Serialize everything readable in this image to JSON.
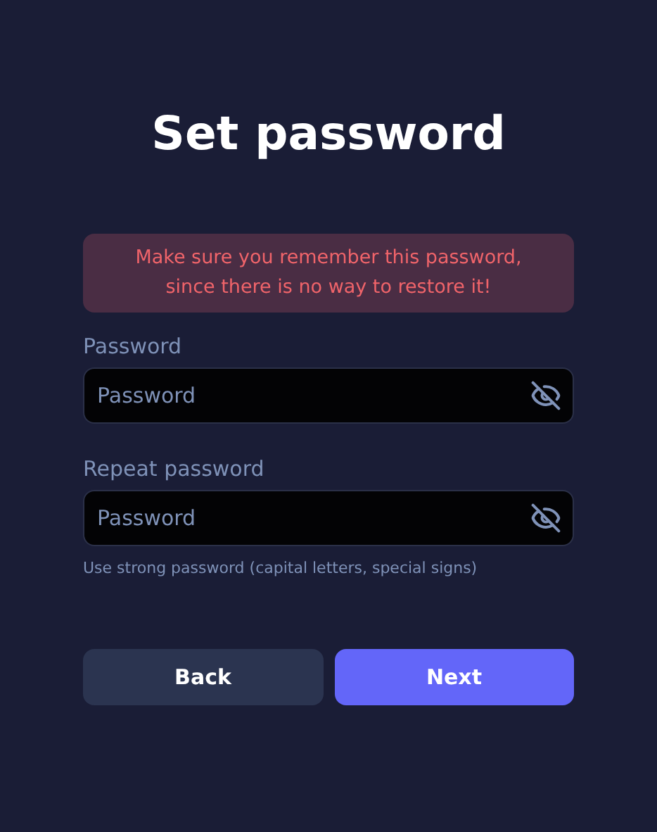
{
  "title": "Set password",
  "warning": "Make sure you remember this password, since there is no way to restore it!",
  "fields": [
    {
      "label": "Password",
      "placeholder": "Password"
    },
    {
      "label": "Repeat password",
      "placeholder": "Password"
    }
  ],
  "hint": "Use strong password (capital letters, special signs)",
  "buttons": [
    {
      "label": "Back",
      "kind": "secondary"
    },
    {
      "label": "Next",
      "kind": "primary"
    }
  ]
}
